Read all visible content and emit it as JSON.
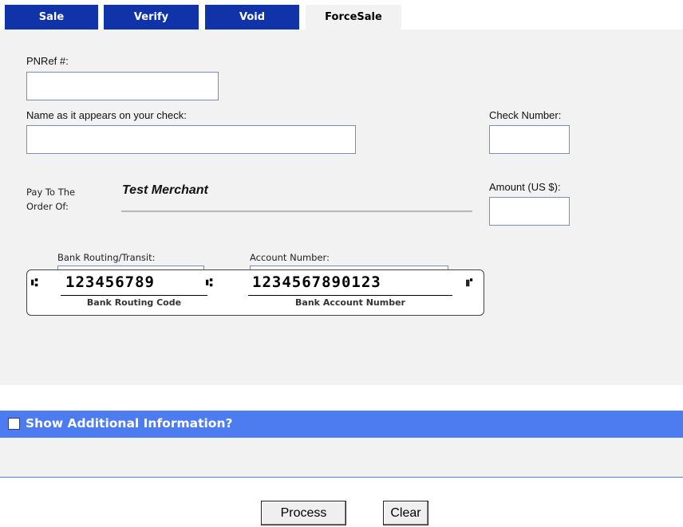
{
  "tabs": [
    {
      "label": "Sale",
      "active": false
    },
    {
      "label": "Verify",
      "active": false
    },
    {
      "label": "Void",
      "active": false
    },
    {
      "label": "ForceSale",
      "active": true
    }
  ],
  "form": {
    "pnref_label": "PNRef #:",
    "pnref_value": "",
    "name_label": "Name as it appears on your check:",
    "name_value": "",
    "check_number_label": "Check Number:",
    "check_number_value": "",
    "amount_label": "Amount (US $):",
    "amount_value": "",
    "pay_to_label_line1": "Pay To The",
    "pay_to_label_line2": "Order Of:",
    "merchant_name": "Test Merchant",
    "routing_label": "Bank Routing/Transit:",
    "routing_value": "",
    "account_label": "Account Number:",
    "account_value": ""
  },
  "micr": {
    "transit_symbol": "⑆",
    "routing_digits": "123456789",
    "account_digits": "1234567890123",
    "onus_symbol": "⑈",
    "routing_caption": "Bank Routing Code",
    "account_caption": "Bank Account Number"
  },
  "additional": {
    "label": "Show Additional Information?",
    "checked": false
  },
  "buttons": {
    "process": "Process",
    "clear": "Clear"
  },
  "colors": {
    "tab_blue": "#1133aa",
    "panel_gray": "#f2f2f2",
    "addl_bar_blue": "#4c7cf0"
  }
}
